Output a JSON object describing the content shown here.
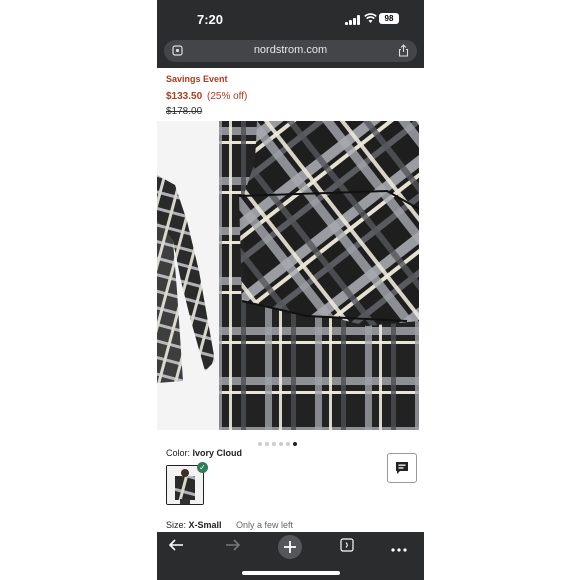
{
  "status_bar": {
    "time": "7:20",
    "battery": "98"
  },
  "browser": {
    "url": "nordstrom.com"
  },
  "product": {
    "sale_label": "Savings Event",
    "sale_price": "$133.50",
    "discount": "(25% off)",
    "original_price": "$178.00",
    "color_label": "Color:",
    "color_value": "Ivory Cloud",
    "size_label": "Size:",
    "size_value": "X-Small",
    "stock_note": "Only a few left",
    "gallery_dots": 6,
    "active_dot": 6
  },
  "icons": [
    "site-settings-icon",
    "share-icon",
    "chat-icon",
    "back-icon",
    "forward-icon",
    "new-tab-icon",
    "tabs-icon",
    "more-icon"
  ],
  "colors": {
    "sale_red": "#b23b1e",
    "chrome_dark": "#2b2c2e",
    "check_green": "#2e7d5a"
  }
}
